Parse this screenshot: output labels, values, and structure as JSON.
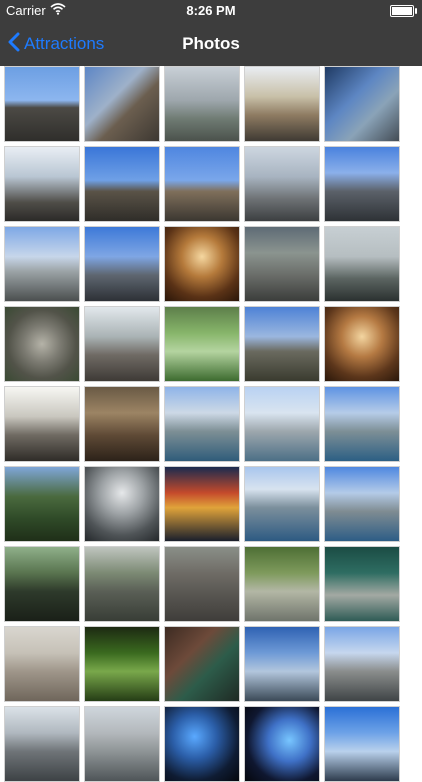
{
  "status": {
    "carrier": "Carrier",
    "time": "8:26 PM"
  },
  "nav": {
    "back_label": "Attractions",
    "title": "Photos"
  },
  "thumbnails": [
    [
      "linear-gradient(180deg,#6c9fe3 0%,#8db6ef 45%,#4c4a45 55%,#2f2e2b 100%)"
    ],
    [
      "linear-gradient(135deg,#5d86c6 0%,#9eb1c9 40%,#6b5e4f 60%,#3d3832 100%)"
    ],
    [
      "linear-gradient(180deg,#c8cfd6 0%,#9ea7ad 45%,#6f7b73 70%,#4b524c 100%)"
    ],
    [
      "linear-gradient(180deg,#e9edf2 0%,#c8c0a8 40%,#8e7b62 65%,#3f3a33 100%)"
    ],
    [
      "linear-gradient(135deg,#1f3a63 0%,#5d86c3 40%,#8aa3b8 65%,#434c55 100%)"
    ],
    [
      "linear-gradient(180deg,#e9eef4 0%,#b9c6d3 40%,#4f4d48 75%,#2b2a28 100%)"
    ],
    [
      "linear-gradient(180deg,#3a76d8 0%,#6fa0e6 45%,#5a5347 60%,#2f2d29 100%)"
    ],
    [
      "linear-gradient(180deg,#4f86e0 0%,#7aa7ea 45%,#7f6f5b 60%,#3b3731 100%)"
    ],
    [
      "linear-gradient(180deg,#cdd6e0 0%,#a8b4c1 40%,#6e7275 70%,#3c3f41 100%)"
    ],
    [
      "linear-gradient(180deg,#4a82de 0%,#8bb0ea 35%,#5b6169 60%,#2e3236 100%)"
    ],
    [
      "linear-gradient(180deg,#7ea8e6 0%,#c7d6ea 40%,#9ba3a6 60%,#4b4f4f 100%)"
    ],
    [
      "linear-gradient(180deg,#3d79d8 0%,#7fa6e4 40%,#5e6670 65%,#2d3136 100%)"
    ],
    [
      "radial-gradient(circle at 50% 40%,#f5d7a0 0%,#b57a3b 35%,#5a3216 70%,#2a1609 100%)"
    ],
    [
      "linear-gradient(180deg,#5e6b75 0%,#8b948f 35%,#6a6d69 65%,#3b3d3b 100%)"
    ],
    [
      "linear-gradient(180deg,#c7cfd3 0%,#b6bec1 40%,#5b6461 70%,#2b3130 100%)"
    ],
    [
      "radial-gradient(circle at 50% 50%,#b5b3a8 0%,#7c7b72 35%,#525349 65%,#3a4a33 100%)"
    ],
    [
      "linear-gradient(180deg,#e2e8ec 0%,#aab3b5 40%,#6f6a64 65%,#3e3a36 100%)"
    ],
    [
      "linear-gradient(180deg,#5d7f4a 0%,#87b56a 35%,#b4d4a0 60%,#3d6b2f 100%)"
    ],
    [
      "linear-gradient(180deg,#4e82d6 0%,#9bb7df 40%,#6a6a5f 60%,#3a3b2f 100%)"
    ],
    [
      "radial-gradient(circle at 50% 40%,#f3d5a0 0%,#b57a43 35%,#5c361b 70%,#2a170a 100%)"
    ],
    [
      "linear-gradient(180deg,#f7f7f3 0%,#c9c7bf 40%,#6f6a62 65%,#2f2c28 100%)"
    ],
    [
      "linear-gradient(180deg,#6a5a45 0%,#9c8464 35%,#5f4a36 65%,#2c2219 100%)"
    ],
    [
      "linear-gradient(180deg,#8fb4e8 0%,#cdd9e6 35%,#7d8f95 60%,#2f5c7a 100%)"
    ],
    [
      "linear-gradient(180deg,#b9d2f2 0%,#d9e4f0 35%,#9da7ad 60%,#4c6f86 100%)"
    ],
    [
      "linear-gradient(180deg,#5e93e3 0%,#b6cce8 35%,#7d8f96 60%,#2c5f84 100%)"
    ],
    [
      "linear-gradient(180deg,#7fa6d8 0%,#4a6a3e 40%,#2f4a28 70%,#1f2f18 100%)"
    ],
    [
      "radial-gradient(circle at 50% 35%,#e6e8ea 0%,#9ea3a6 35%,#4f5457 70%,#24282b 100%)"
    ],
    [
      "linear-gradient(180deg,#1b2b4f 0%,#c54a2b 35%,#e0a33a 55%,#1a1f2c 100%)"
    ],
    [
      "linear-gradient(180deg,#a9c6ee 0%,#d8e3ef 30%,#7b8f9c 55%,#2d5a82 100%)"
    ],
    [
      "linear-gradient(180deg,#4f88e0 0%,#b4cbe8 35%,#7f8c92 60%,#2d5d86 100%)"
    ],
    [
      "linear-gradient(180deg,#8fb08a 0%,#59744f 35%,#2e3a2b 60%,#1a2018 100%)"
    ],
    [
      "linear-gradient(180deg,#bfc5bf 0%,#7c8a74 35%,#5a5f56 60%,#383d36 100%)"
    ],
    [
      "linear-gradient(180deg,#8a8f88 0%,#6f6c66 35%,#5b5954 60%,#3f3d3a 100%)"
    ],
    [
      "linear-gradient(180deg,#4e6f35 0%,#7e9a5c 35%,#b3b7a5 60%,#6f746b 100%)"
    ],
    [
      "linear-gradient(180deg,#1b4c44 0%,#2e6d62 35%,#a3a9a3 65%,#2f5b55 100%)"
    ],
    [
      "linear-gradient(180deg,#d9d6cf 0%,#c6c1b7 35%,#9f968a 60%,#6f665b 100%)"
    ],
    [
      "linear-gradient(180deg,#1d2a12 0%,#3a6a1f 35%,#79a84b 60%,#253d15 100%)"
    ],
    [
      "linear-gradient(135deg,#3d2b22 0%,#6d4a3a 35%,#2d5c4a 60%,#1f2a24 100%)"
    ],
    [
      "linear-gradient(180deg,#2f62b3 0%,#6e9ad6 35%,#b2c6dd 60%,#3b4a57 100%)"
    ],
    [
      "linear-gradient(180deg,#7aa6e6 0%,#c6d7ee 35%,#8a8d8c 60%,#3f4446 100%)"
    ],
    [
      "linear-gradient(180deg,#dbe2e8 0%,#b0b8bf 35%,#6f7478 60%,#3d4245 100%)"
    ],
    [
      "linear-gradient(180deg,#cfd6dc 0%,#b3b8bc 35%,#8e9496 60%,#4f5558 100%)"
    ],
    [
      "radial-gradient(circle at 40% 40%,#5aa9ff 0%,#2b5ea8 35%,#0f1c33 70%,#05070d 100%)"
    ],
    [
      "radial-gradient(circle at 60% 45%,#78c6ff 0%,#3f71c7 35%,#0f1730 70%,#05070d 100%)"
    ],
    [
      "linear-gradient(180deg,#2b70d6 0%,#6da2e7 35%,#b9d1ec 60%,#2e3c4d 100%)"
    ]
  ]
}
